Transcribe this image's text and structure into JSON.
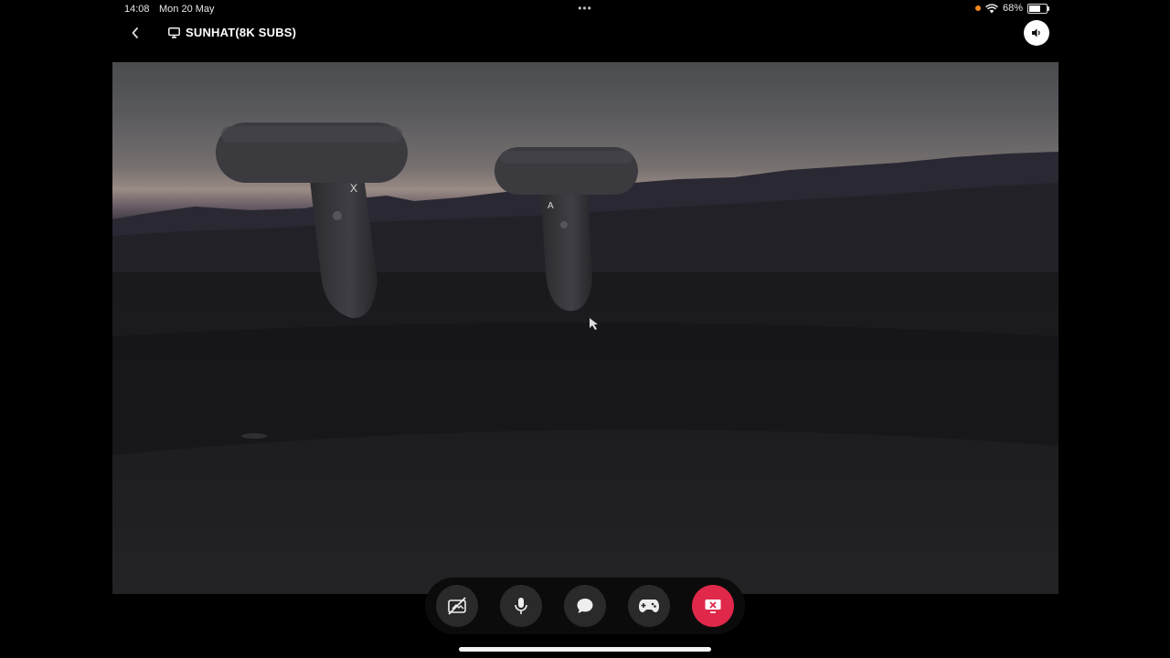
{
  "status_bar": {
    "time": "14:08",
    "date": "Mon 20 May",
    "dots": "•••",
    "battery_text": "68%",
    "battery_level": 0.68,
    "icons": [
      "orange-dot-indicator",
      "wifi-icon",
      "battery-icon"
    ]
  },
  "header": {
    "back_icon": "chevron-left-icon",
    "title_icon": "monitor-icon",
    "title": "SUNHAT(8K SUBS)",
    "volume_icon": "speaker-icon"
  },
  "stream": {
    "left_controller_button": "X",
    "right_controller_button": "A"
  },
  "toolbar": {
    "buttons": [
      {
        "name": "video-off",
        "icon": "camera-off-icon"
      },
      {
        "name": "microphone",
        "icon": "mic-icon"
      },
      {
        "name": "chat",
        "icon": "chat-bubble-icon"
      },
      {
        "name": "controller",
        "icon": "gamepad-icon"
      },
      {
        "name": "end-stream",
        "icon": "end-stream-icon"
      }
    ]
  },
  "colors": {
    "background": "#000000",
    "toolbar": "#0b0b0b",
    "button": "#2a2a2a",
    "end_button": "#e0284a",
    "battery_dot": "#f08a24"
  }
}
